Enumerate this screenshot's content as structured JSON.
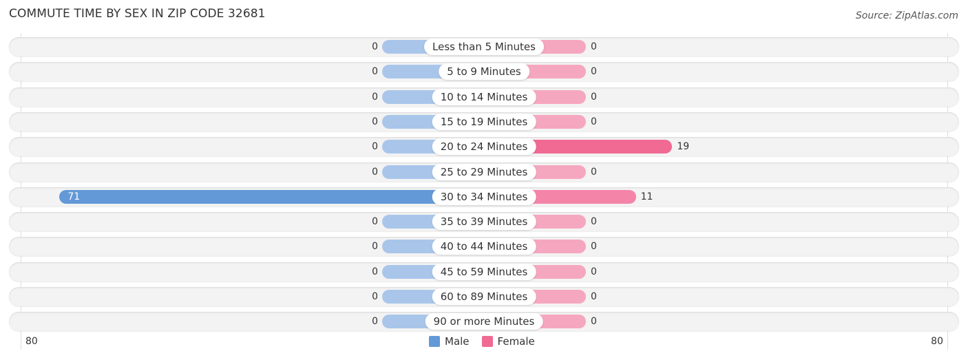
{
  "header": {
    "title": "COMMUTE TIME BY SEX IN ZIP CODE 32681",
    "source": "Source: ZipAtlas.com"
  },
  "chart_data": {
    "type": "bar",
    "orientation": "horizontal-diverging",
    "title": "COMMUTE TIME BY SEX IN ZIP CODE 32681",
    "categories": [
      "Less than 5 Minutes",
      "5 to 9 Minutes",
      "10 to 14 Minutes",
      "15 to 19 Minutes",
      "20 to 24 Minutes",
      "25 to 29 Minutes",
      "30 to 34 Minutes",
      "35 to 39 Minutes",
      "40 to 44 Minutes",
      "45 to 59 Minutes",
      "60 to 89 Minutes",
      "90 or more Minutes"
    ],
    "series": [
      {
        "name": "Male",
        "color": "#6399d6",
        "values": [
          0,
          0,
          0,
          0,
          0,
          0,
          71,
          0,
          0,
          0,
          0,
          0
        ]
      },
      {
        "name": "Female",
        "color": "#f06a93",
        "values": [
          0,
          0,
          0,
          0,
          19,
          0,
          11,
          0,
          0,
          0,
          0,
          0
        ]
      }
    ],
    "xlim": [
      -80,
      80
    ],
    "tick_labels": {
      "left": "80",
      "right": "80"
    },
    "legend_position": "bottom-center"
  },
  "legend": [
    {
      "label": "Male",
      "color": "#6399d6"
    },
    {
      "label": "Female",
      "color": "#f06a93"
    }
  ]
}
